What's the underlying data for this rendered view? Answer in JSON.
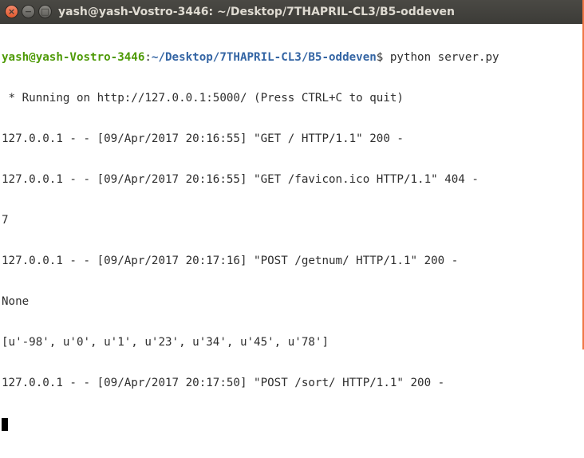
{
  "window": {
    "title": "yash@yash-Vostro-3446: ~/Desktop/7THAPRIL-CL3/B5-oddeven",
    "close_glyph": "×",
    "minimize_glyph": "−",
    "maximize_glyph": "□"
  },
  "terminal": {
    "prompt_user": "yash@yash-Vostro-3446",
    "prompt_colon": ":",
    "prompt_path": "~/Desktop/7THAPRIL-CL3/B5-oddeven",
    "prompt_symbol": "$ ",
    "command": "python server.py",
    "lines": [
      " * Running on http://127.0.0.1:5000/ (Press CTRL+C to quit)",
      "127.0.0.1 - - [09/Apr/2017 20:16:55] \"GET / HTTP/1.1\" 200 -",
      "127.0.0.1 - - [09/Apr/2017 20:16:55] \"GET /favicon.ico HTTP/1.1\" 404 -",
      "7",
      "127.0.0.1 - - [09/Apr/2017 20:17:16] \"POST /getnum/ HTTP/1.1\" 200 -",
      "None",
      "[u'-98', u'0', u'1', u'23', u'34', u'45', u'78']",
      "127.0.0.1 - - [09/Apr/2017 20:17:50] \"POST /sort/ HTTP/1.1\" 200 -"
    ]
  },
  "colors": {
    "titlebar": "#3c3b37",
    "prompt_user": "#4e9a06",
    "prompt_path": "#3465a4",
    "close_button": "#e95420",
    "window_accent": "#f07746"
  }
}
